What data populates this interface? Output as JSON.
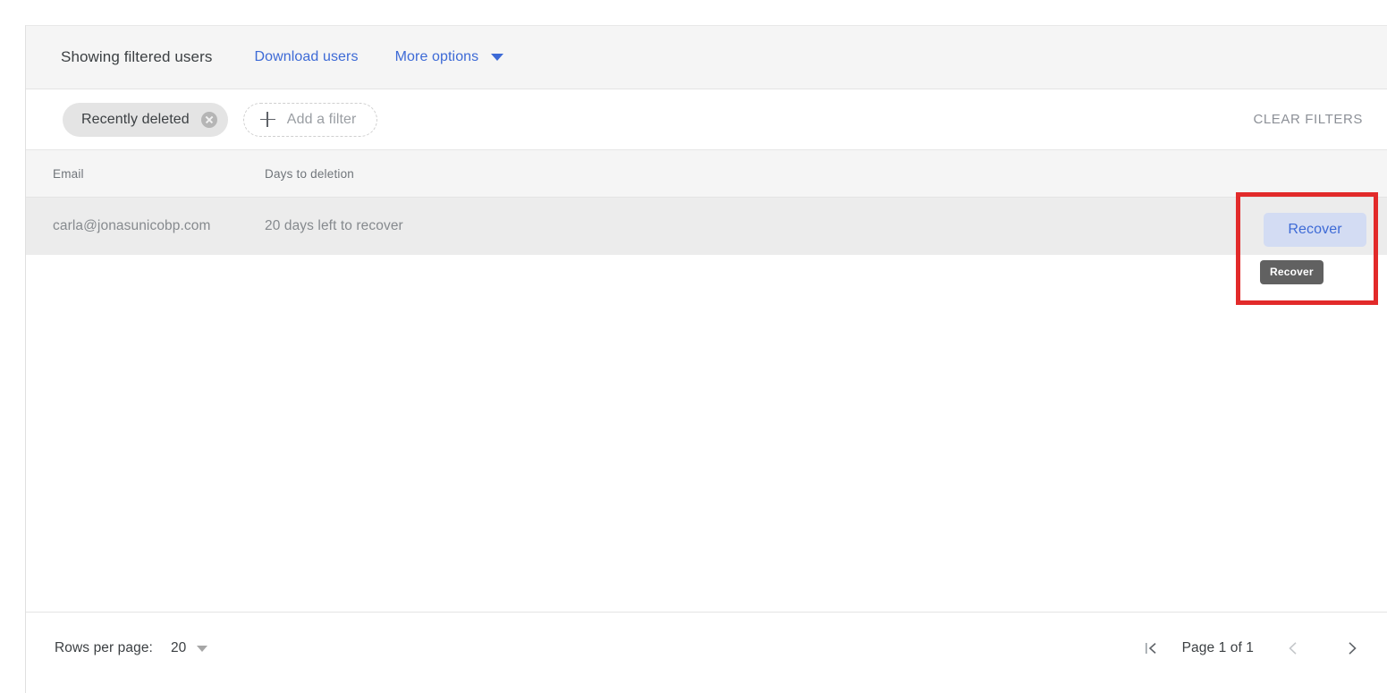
{
  "toolbar": {
    "title": "Showing filtered users",
    "download_label": "Download users",
    "more_options_label": "More options"
  },
  "filters": {
    "chip_label": "Recently deleted",
    "add_filter_label": "Add a filter",
    "clear_filters_label": "CLEAR FILTERS"
  },
  "table": {
    "columns": {
      "email": "Email",
      "days": "Days to deletion"
    },
    "rows": [
      {
        "email": "carla@jonasunicobp.com",
        "days": "20 days left to recover",
        "action_label": "Recover"
      }
    ]
  },
  "tooltip": {
    "text": "Recover"
  },
  "footer": {
    "rows_per_page_label": "Rows per page:",
    "rows_per_page_value": "20",
    "page_label": "Page 1 of 1"
  },
  "colors": {
    "accent_blue": "#3d6ad6",
    "button_bg": "#d3dcf3",
    "tooltip_bg": "#616161",
    "highlight_red": "#e22a2a",
    "header_bg": "#f5f5f5",
    "row_bg": "#ececec"
  }
}
